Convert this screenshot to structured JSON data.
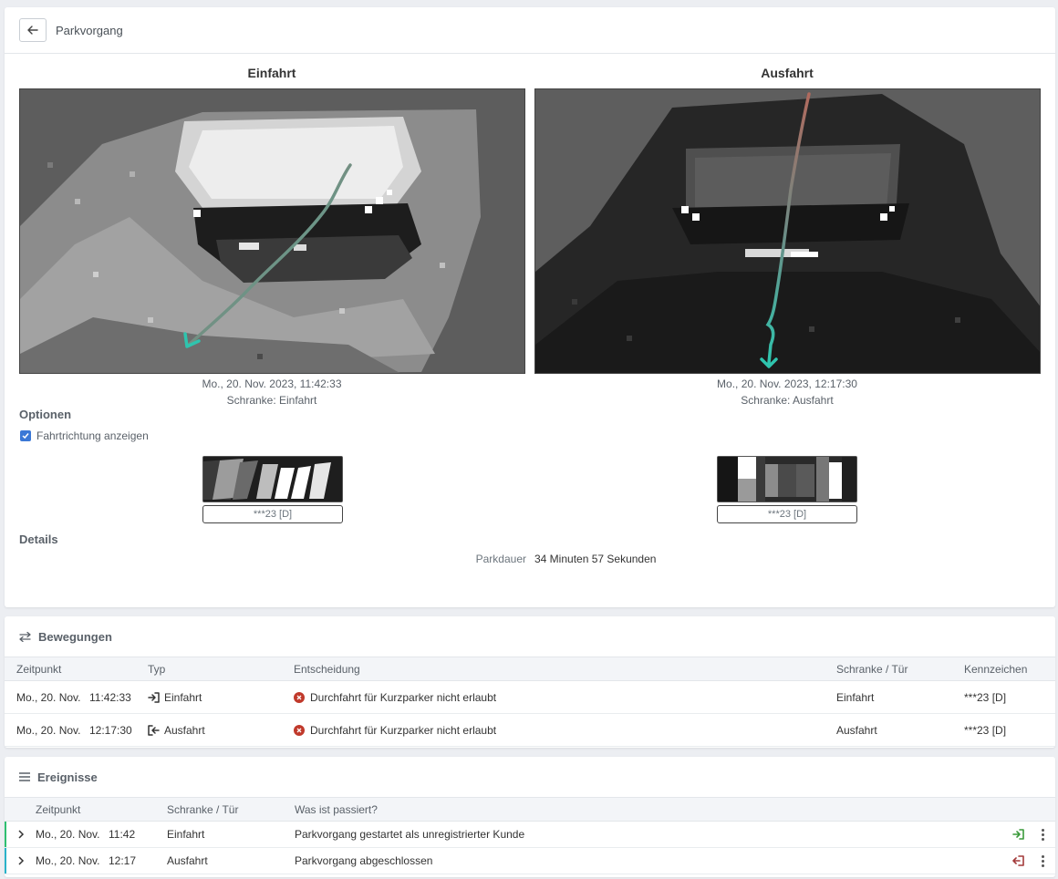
{
  "header": {
    "title": "Parkvorgang"
  },
  "entry": {
    "title": "Einfahrt",
    "timestamp": "Mo., 20. Nov. 2023, 11:42:33",
    "gate": "Schranke: Einfahrt",
    "plate": "***23 [D]"
  },
  "exit": {
    "title": "Ausfahrt",
    "timestamp": "Mo., 20. Nov. 2023, 12:17:30",
    "gate": "Schranke: Ausfahrt",
    "plate": "***23 [D]"
  },
  "options": {
    "title": "Optionen",
    "show_direction_label": "Fahrtrichtung anzeigen",
    "show_direction_checked": true
  },
  "details": {
    "title": "Details",
    "duration_label": "Parkdauer",
    "duration_value": "34 Minuten 57 Sekunden"
  },
  "movements": {
    "title": "Bewegungen",
    "columns": [
      "Zeitpunkt",
      "Typ",
      "Entscheidung",
      "Schranke / Tür",
      "Kennzeichen"
    ],
    "rows": [
      {
        "date": "Mo., 20. Nov.",
        "time": "11:42:33",
        "type": "Einfahrt",
        "decision": "Durchfahrt für Kurzparker nicht erlaubt",
        "gate": "Einfahrt",
        "plate": "***23 [D]"
      },
      {
        "date": "Mo., 20. Nov.",
        "time": "12:17:30",
        "type": "Ausfahrt",
        "decision": "Durchfahrt für Kurzparker nicht erlaubt",
        "gate": "Ausfahrt",
        "plate": "***23 [D]"
      }
    ]
  },
  "events": {
    "title": "Ereignisse",
    "columns": [
      "Zeitpunkt",
      "Schranke / Tür",
      "Was ist passiert?"
    ],
    "rows": [
      {
        "date": "Mo., 20. Nov.",
        "time": "11:42",
        "gate": "Einfahrt",
        "what": "Parkvorgang gestartet als unregistrierter Kunde",
        "accent": "#2fbf71",
        "icon_color": "#3a9a3a"
      },
      {
        "date": "Mo., 20. Nov.",
        "time": "12:17",
        "gate": "Ausfahrt",
        "what": "Parkvorgang abgeschlossen",
        "accent": "#2ab3c9",
        "icon_color": "#a33a3a"
      }
    ]
  },
  "colors": {
    "accent": "#3b78d6",
    "error": "#c0392b",
    "trail_start": "#b06a5e",
    "trail_end": "#2fc4ae"
  }
}
